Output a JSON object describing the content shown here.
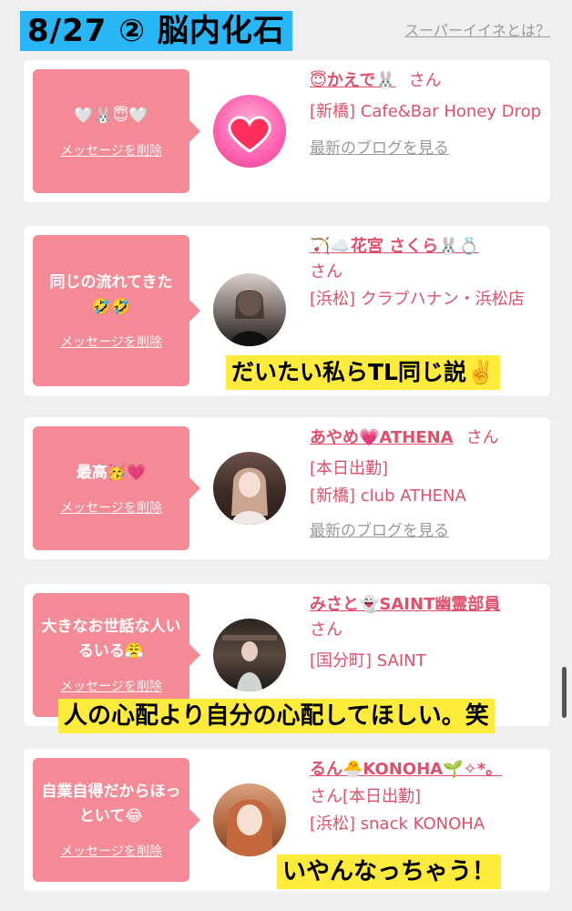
{
  "header": {
    "title": "8/27 ② 脳内化石",
    "link": "スーパーイイネとは？"
  },
  "cards": [
    {
      "message": "🤍🐰😇🤍",
      "delete_label": "メッセージを削除",
      "name": "😇かえで🐰",
      "san": "さん",
      "lines": [
        "[新橋] Cafe&Bar Honey Drop"
      ],
      "blog": "最新のブログを見る"
    },
    {
      "message": "同じの流れてきた🤣🤣",
      "delete_label": "メッセージを削除",
      "name": "🏹☁️花宮 さくら🐰💍",
      "san": "さん",
      "lines": [
        "[浜松] クラブハナン・浜松店"
      ],
      "caption": "だいたい私らTL同じ説✌️"
    },
    {
      "message": "最高🥳💗",
      "delete_label": "メッセージを削除",
      "name": "あやめ💗ATHENA",
      "san": "さん",
      "lines": [
        "[本日出勤]",
        "[新橋] club ATHENA"
      ],
      "blog": "最新のブログを見る"
    },
    {
      "message": "大きなお世話な人いるいる😤",
      "delete_label": "メッセージを削除",
      "name": "みさと👻SAINT幽霊部員",
      "san": "さん",
      "lines": [
        "[国分町] SAINT"
      ],
      "caption": "人の心配より自分の心配してほしい。笑"
    },
    {
      "message": "自業自得だからほっといて😂",
      "delete_label": "メッセージを削除",
      "name": "るん🐣KONOHA🌱✧*。",
      "san": "さん",
      "lines": [
        "[本日出勤]",
        "[浜松] snack KONOHA"
      ],
      "caption": "いやんなっちゃう！"
    }
  ],
  "colors": {
    "bubble": "#f48a96",
    "name": "#e0506a",
    "title_bg": "#29b6f6",
    "caption_bg": "#ffeb3b"
  }
}
